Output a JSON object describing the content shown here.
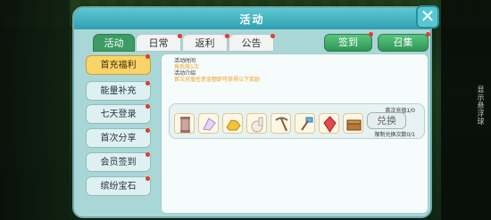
{
  "dialog": {
    "title": "活动",
    "close_icon": "close-x-icon"
  },
  "tabs": [
    {
      "label": "活动",
      "active": true
    },
    {
      "label": "日常",
      "active": false
    },
    {
      "label": "返利",
      "active": false
    },
    {
      "label": "公告",
      "active": false
    }
  ],
  "top_buttons": {
    "checkin": "签到",
    "summon": "召集"
  },
  "sidebar": {
    "items": [
      {
        "label": "首充福利",
        "selected": true
      },
      {
        "label": "能量补充",
        "selected": false
      },
      {
        "label": "七天登录",
        "selected": false
      },
      {
        "label": "首次分享",
        "selected": false
      },
      {
        "label": "会员签到",
        "selected": false
      },
      {
        "label": "缤纷宝石",
        "selected": false
      }
    ]
  },
  "content": {
    "time_key": "活动时间",
    "time_value": "角色限1次",
    "intro_key": "活动介绍",
    "intro_value": "首次充值任意金额即可获得以下奖励",
    "reward": {
      "first_recharge": "首次充值1/0",
      "exchange_button": "兑换",
      "limit": "限制兑换次数0/1",
      "items": [
        {
          "name": "pillar-icon"
        },
        {
          "name": "crystal-feather-icon"
        },
        {
          "name": "gold-nugget-icon"
        },
        {
          "name": "alpaca-icon"
        },
        {
          "name": "pickaxe-icon"
        },
        {
          "name": "hammer-icon"
        },
        {
          "name": "red-gem-icon"
        },
        {
          "name": "chest-icon"
        }
      ]
    }
  },
  "vertical_tip": "显示悬浮球"
}
